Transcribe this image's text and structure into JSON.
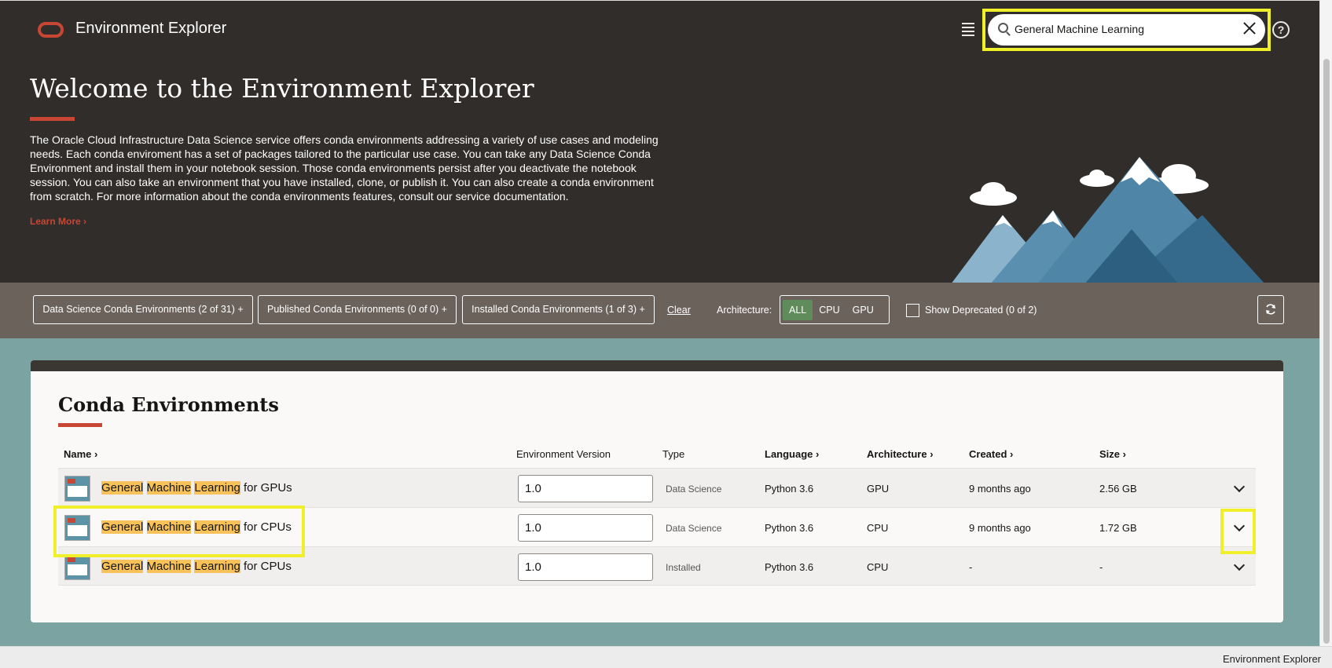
{
  "header": {
    "app_title": "Environment Explorer",
    "search_value": "General Machine Learning",
    "icons": [
      "oracle-logo",
      "list-icon",
      "search-icon",
      "clear-icon",
      "help-icon"
    ]
  },
  "hero": {
    "title": "Welcome to the Environment Explorer",
    "description": "The Oracle Cloud Infrastructure Data Science service offers conda environments addressing a variety of use cases and modeling needs. Each conda enviroment has a set of packages tailored to the particular use case. You can take any Data Science Conda Environment and install them in your notebook session. Those conda environments persist after you deactivate the notebook session. You can also take an environment that you have installed, clone, or publish it. You can also create a conda environment from scratch. For more information about the conda environments features, consult our service documentation.",
    "learn_more": "Learn More"
  },
  "filters": {
    "data_science": "Data Science Conda Environments (2 of 31)",
    "published": "Published Conda Environments (0 of 0)",
    "installed": "Installed Conda Environments (1 of 3)",
    "plus": "+",
    "clear": "Clear",
    "architecture_label": "Architecture:",
    "arch_options": [
      "ALL",
      "CPU",
      "GPU"
    ],
    "arch_selected": "ALL",
    "show_deprecated": "Show Deprecated (0 of 2)",
    "show_deprecated_checked": false
  },
  "table": {
    "title": "Conda Environments",
    "columns": {
      "name": "Name",
      "version": "Environment Version",
      "type": "Type",
      "language": "Language",
      "architecture": "Architecture",
      "created": "Created",
      "size": "Size"
    },
    "sort_glyph": "›",
    "rows": [
      {
        "w1": "General",
        "w2": "Machine",
        "w3": "Learning",
        "suffix": " for GPUs",
        "version": "1.0",
        "type": "Data Science",
        "language": "Python 3.6",
        "architecture": "GPU",
        "created": "9 months ago",
        "size": "2.56 GB"
      },
      {
        "w1": "General",
        "w2": "Machine",
        "w3": "Learning",
        "suffix": " for CPUs",
        "version": "1.0",
        "type": "Data Science",
        "language": "Python 3.6",
        "architecture": "CPU",
        "created": "9 months ago",
        "size": "1.72 GB"
      },
      {
        "w1": "General",
        "w2": "Machine",
        "w3": "Learning",
        "suffix": " for CPUs",
        "version": "1.0",
        "type": "Installed",
        "language": "Python 3.6",
        "architecture": "CPU",
        "created": "-",
        "size": "-"
      }
    ]
  },
  "colors": {
    "hero_bg": "#312d2a",
    "accent": "#c74634",
    "filter_bar_bg": "#6b625b",
    "active_segment": "#5f8c5a",
    "match_highlight": "#f7c25a",
    "annotation_yellow": "#f0f02a"
  },
  "status_bar": {
    "text": "Environment Explorer"
  }
}
